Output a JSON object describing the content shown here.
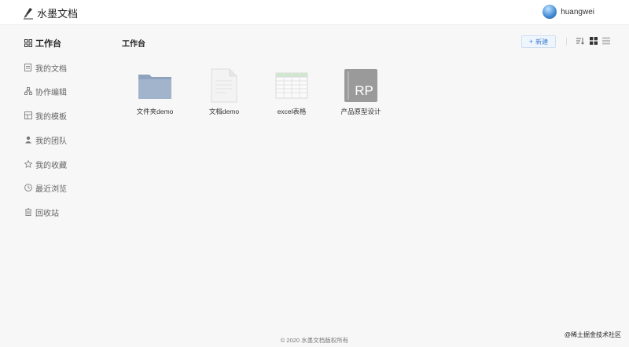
{
  "header": {
    "app_title": "水墨文档",
    "user_name": "huangwei",
    "logo_icon": "brush-icon",
    "avatar_color": "#4a90d9"
  },
  "sidebar": {
    "items": [
      {
        "label": "工作台",
        "icon": "grid-icon",
        "active": true
      },
      {
        "label": "我的文档",
        "icon": "document-icon",
        "active": false
      },
      {
        "label": "协作编辑",
        "icon": "collaborate-icon",
        "active": false
      },
      {
        "label": "我的模板",
        "icon": "template-icon",
        "active": false
      },
      {
        "label": "我的团队",
        "icon": "team-icon",
        "active": false
      },
      {
        "label": "我的收藏",
        "icon": "star-icon",
        "active": false
      },
      {
        "label": "最近浏览",
        "icon": "clock-icon",
        "active": false
      },
      {
        "label": "回收站",
        "icon": "trash-icon",
        "active": false
      }
    ]
  },
  "main": {
    "title": "工作台",
    "new_button_label": "新建",
    "accent_color": "#3d7ccf",
    "files": [
      {
        "name": "文件夹demo",
        "type": "folder",
        "icon": "folder-icon"
      },
      {
        "name": "文档demo",
        "type": "document",
        "icon": "document-file-icon"
      },
      {
        "name": "excel表格",
        "type": "spreadsheet",
        "icon": "spreadsheet-icon"
      },
      {
        "name": "产品原型设计",
        "type": "prototype",
        "icon": "rp-prototype-icon"
      }
    ]
  },
  "footer": {
    "copyright": "© 2020 水墨文档版权所有",
    "watermark": "@稀土掘金技术社区"
  }
}
